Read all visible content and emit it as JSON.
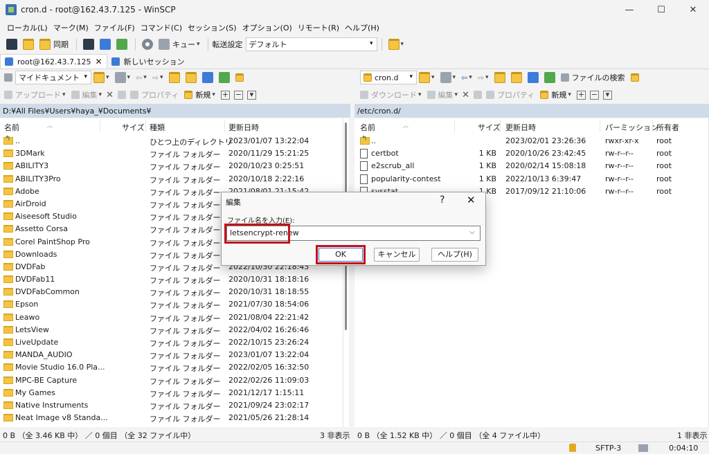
{
  "window": {
    "title": "cron.d - root@162.43.7.125 - WinSCP"
  },
  "menu": [
    "ローカル(L)",
    "マーク(M)",
    "ファイル(F)",
    "コマンド(C)",
    "セッション(S)",
    "オプション(O)",
    "リモート(R)",
    "ヘルプ(H)"
  ],
  "toolbar": {
    "sync_label": "同期",
    "queue_label": "キュー",
    "transfer_label": "転送設定",
    "transfer_value": "デフォルト"
  },
  "tabs": {
    "session": "root@162.43.7.125",
    "new_session": "新しいセッション"
  },
  "local": {
    "location": "マイドキュメント",
    "upload": "アップロード",
    "edit": "編集",
    "properties": "プロパティ",
    "new": "新規",
    "path": "D:¥All Files¥Users¥haya_¥Documents¥",
    "columns": {
      "name": "名前",
      "size": "サイズ",
      "type": "種類",
      "modified": "更新日時"
    },
    "rows": [
      {
        "name": "..",
        "type": "ひとつ上のディレクトリ",
        "date": "2023/01/07 13:22:04",
        "up": true
      },
      {
        "name": "3DMark",
        "type": "ファイル フォルダー",
        "date": "2020/11/29 15:21:25"
      },
      {
        "name": "ABILITY3",
        "type": "ファイル フォルダー",
        "date": "2020/10/23 0:25:51"
      },
      {
        "name": "ABILITY3Pro",
        "type": "ファイル フォルダー",
        "date": "2020/10/18 2:22:16"
      },
      {
        "name": "Adobe",
        "type": "ファイル フォルダー",
        "date": "2021/08/01 21:15:42"
      },
      {
        "name": "AirDroid",
        "type": "ファイル フォルダー",
        "date": ""
      },
      {
        "name": "Aiseesoft Studio",
        "type": "ファイル フォルダー",
        "date": ""
      },
      {
        "name": "Assetto Corsa",
        "type": "ファイル フォルダー",
        "date": ""
      },
      {
        "name": "Corel PaintShop Pro",
        "type": "ファイル フォルダー",
        "date": ""
      },
      {
        "name": "Downloads",
        "type": "ファイル フォルダー",
        "date": ""
      },
      {
        "name": "DVDFab",
        "type": "ファイル フォルダー",
        "date": "2022/10/30 22:18:43"
      },
      {
        "name": "DVDFab11",
        "type": "ファイル フォルダー",
        "date": "2020/10/31 18:18:16"
      },
      {
        "name": "DVDFabCommon",
        "type": "ファイル フォルダー",
        "date": "2020/10/31 18:18:55"
      },
      {
        "name": "Epson",
        "type": "ファイル フォルダー",
        "date": "2021/07/30 18:54:06"
      },
      {
        "name": "Leawo",
        "type": "ファイル フォルダー",
        "date": "2021/08/04 22:21:42"
      },
      {
        "name": "LetsView",
        "type": "ファイル フォルダー",
        "date": "2022/04/02 16:26:46"
      },
      {
        "name": "LiveUpdate",
        "type": "ファイル フォルダー",
        "date": "2022/10/15 23:26:24"
      },
      {
        "name": "MANDA_AUDIO",
        "type": "ファイル フォルダー",
        "date": "2023/01/07 13:22:04"
      },
      {
        "name": "Movie Studio 16.0 Pla...",
        "type": "ファイル フォルダー",
        "date": "2022/02/05 16:32:50"
      },
      {
        "name": "MPC-BE Capture",
        "type": "ファイル フォルダー",
        "date": "2022/02/26 11:09:03"
      },
      {
        "name": "My Games",
        "type": "ファイル フォルダー",
        "date": "2021/12/17 1:15:11"
      },
      {
        "name": "Native Instruments",
        "type": "ファイル フォルダー",
        "date": "2021/09/24 23:02:17"
      },
      {
        "name": "Neat Image v8 Standa...",
        "type": "ファイル フォルダー",
        "date": "2021/05/26 21:28:14"
      }
    ],
    "status": "0 B （全 3.46 KB 中） ／ 0 個目 （全 32 ファイル中）",
    "hidden": "3 非表示"
  },
  "remote": {
    "location": "cron.d",
    "download": "ダウンロード",
    "edit": "編集",
    "properties": "プロパティ",
    "new": "新規",
    "find": "ファイルの検索",
    "path": "/etc/cron.d/",
    "columns": {
      "name": "名前",
      "size": "サイズ",
      "modified": "更新日時",
      "perms": "パーミッション",
      "owner": "所有者"
    },
    "rows": [
      {
        "name": "..",
        "size": "",
        "date": "2023/02/01 23:26:36",
        "perms": "rwxr-xr-x",
        "owner": "root",
        "up": true
      },
      {
        "name": "certbot",
        "size": "1 KB",
        "date": "2020/10/26 23:42:45",
        "perms": "rw-r--r--",
        "owner": "root"
      },
      {
        "name": "e2scrub_all",
        "size": "1 KB",
        "date": "2020/02/14 15:08:18",
        "perms": "rw-r--r--",
        "owner": "root"
      },
      {
        "name": "popularity-contest",
        "size": "1 KB",
        "date": "2022/10/13 6:39:47",
        "perms": "rw-r--r--",
        "owner": "root"
      },
      {
        "name": "sysstat",
        "size": "1 KB",
        "date": "2017/09/12 21:10:06",
        "perms": "rw-r--r--",
        "owner": "root"
      }
    ],
    "status": "0 B （全 1.52 KB 中） ／ 0 個目 （全 4 ファイル中）",
    "hidden": "1 非表示"
  },
  "bottom": {
    "protocol": "SFTP-3",
    "time": "0:04:10"
  },
  "dialog": {
    "title": "編集",
    "help_glyph": "?",
    "close_glyph": "✕",
    "label": "ファイル名を入力(E):",
    "value": "letsencrypt-renew",
    "ok": "OK",
    "cancel": "キャンセル",
    "help": "ヘルプ(H)",
    "highlight_color": "#c0141a"
  }
}
